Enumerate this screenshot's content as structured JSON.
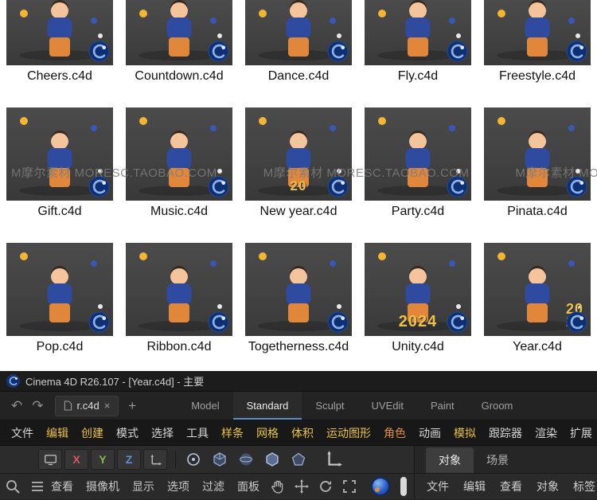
{
  "watermark": {
    "text": "M摩尔素材 MORESC.TAOBAO.COM"
  },
  "grid": {
    "items": [
      {
        "name": "Cheers.c4d"
      },
      {
        "name": "Countdown.c4d"
      },
      {
        "name": "Dance.c4d"
      },
      {
        "name": "Fly.c4d"
      },
      {
        "name": "Freestyle.c4d"
      },
      {
        "name": "Gift.c4d"
      },
      {
        "name": "Music.c4d"
      },
      {
        "name": "New year.c4d",
        "accent": "20"
      },
      {
        "name": "Party.c4d"
      },
      {
        "name": "Pinata.c4d"
      },
      {
        "name": "Pop.c4d"
      },
      {
        "name": "Ribbon.c4d"
      },
      {
        "name": "Togetherness.c4d"
      },
      {
        "name": "Unity.c4d",
        "accent": "2024"
      },
      {
        "name": "Year.c4d",
        "accent": "20\n24"
      }
    ]
  },
  "window": {
    "title": "Cinema 4D R26.107 - [Year.c4d] - 主要",
    "tabs_row": {
      "doc_tab": "r.c4d",
      "close": "×",
      "add_tab": "+",
      "undo": "↶",
      "redo": "↷",
      "layouts": [
        {
          "label": "Model"
        },
        {
          "label": "Standard",
          "active": true
        },
        {
          "label": "Sculpt"
        },
        {
          "label": "UVEdit"
        },
        {
          "label": "Paint"
        },
        {
          "label": "Groom"
        }
      ]
    },
    "menubar": [
      {
        "label": "文件",
        "tone": "white"
      },
      {
        "label": "编辑",
        "tone": "yellow"
      },
      {
        "label": "创建",
        "tone": "yellow"
      },
      {
        "label": "模式",
        "tone": "white"
      },
      {
        "label": "选择",
        "tone": "white"
      },
      {
        "label": "工具",
        "tone": "white"
      },
      {
        "label": "样条",
        "tone": "yellow"
      },
      {
        "label": "网格",
        "tone": "yellow"
      },
      {
        "label": "体积",
        "tone": "yellow"
      },
      {
        "label": "运动图形",
        "tone": "yellow"
      },
      {
        "label": "角色",
        "tone": "orange"
      },
      {
        "label": "动画",
        "tone": "white"
      },
      {
        "label": "模拟",
        "tone": "yellow"
      },
      {
        "label": "跟踪器",
        "tone": "white"
      },
      {
        "label": "渲染",
        "tone": "white"
      },
      {
        "label": "扩展",
        "tone": "white"
      }
    ],
    "toolbar": {
      "axis": [
        "X",
        "Y",
        "Z"
      ],
      "panel_tabs": [
        {
          "label": "对象",
          "active": true
        },
        {
          "label": "场景"
        }
      ]
    },
    "viewport_bar": [
      "查看",
      "摄像机",
      "显示",
      "选项",
      "过滤",
      "面板"
    ],
    "object_bar": [
      "文件",
      "编辑",
      "查看",
      "对象",
      "标签"
    ],
    "colors": {
      "accent_blue": "#5b8cc6",
      "menu_yellow": "#e8c23f",
      "menu_orange": "#e09035",
      "badge_navy": "#0d2f73"
    }
  }
}
